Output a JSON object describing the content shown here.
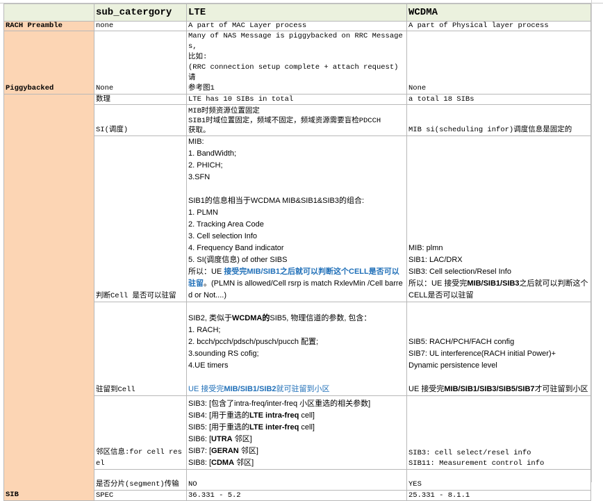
{
  "headers": {
    "col0": "",
    "col1": "sub_catergory",
    "col2": "LTE",
    "col3": "WCDMA"
  },
  "rows": {
    "rach": {
      "category": "RACH Preamble",
      "sub": "none",
      "lte": "A part of MAC Layer process",
      "wcdma": " A part of Physical layer process"
    },
    "piggy": {
      "category": "Piggybacked",
      "sub": "None",
      "lte": [
        "Many of NAS Message is piggybacked on RRC Messages,",
        "比如:",
        " (RRC connection setup complete + attach request) 请",
        "参考图1"
      ],
      "wcdma": "None"
    },
    "count": {
      "sub": "数理",
      "lte": "LTE has 10 SIBs in total",
      "wcdma": "a total 18 SIBs"
    },
    "si": {
      "sub": "SI(调度)",
      "lte": [
        "MIB时频资源位置固定",
        "SIB1时域位置固定，频域不固定，频域资源需要盲检PDCCH",
        "获取。"
      ],
      "wcdma": "MIB si(scheduling infor)调度信息是固定的"
    },
    "judge": {
      "sub": "判断Cell 是否可以驻留",
      "lte": [
        "MIB:",
        "1. BandWidth;",
        "2. PHICH;",
        "3.SFN",
        "",
        "SIB1的信息相当于WCDMA MIB&SIB1&SIB3的组合:",
        "1. PLMN",
        "2. Tracking Area Code",
        "3. Cell selection Info",
        "4. Frequency Band indicator",
        "5. SI(调度信息) of other SIBS"
      ],
      "lte_conclusion_prefix": "所以：UE ",
      "lte_conclusion_blue": "接受完MIB/SIB1之后就可以判断这个CELL是否可以驻留",
      "lte_conclusion_suffix": "。(PLMN is allowed/Cell rsrp is match RxlevMin /Cell barred or Not....)",
      "wcdma": [
        "MIB: plmn",
        "SIB1: LAC/DRX",
        "SIB3: Cell selection/Resel Info"
      ],
      "wcdma_conclusion_prefix": "所以：UE 接受完",
      "wcdma_conclusion_bold": "MIB/SIB1/SIB3",
      "wcdma_conclusion_suffix": "之后就可以判断这个CELL是否可以驻留"
    },
    "camp": {
      "sub": "驻留到Cell",
      "lte_intro_a": "SIB2, 类似于",
      "lte_intro_b": "WCDMA的",
      "lte_intro_c": "SIB5, 物理信道的参数, 包含：",
      "lte": [
        "1. RACH;",
        "2. bcch/pcch/pdsch/pusch/pucch 配置;",
        "3.sounding RS cofig;",
        "4.UE timers"
      ],
      "lte_conclusion_a": "UE 接受完",
      "lte_conclusion_b": "MIB/SIB1/SIB2",
      "lte_conclusion_c": "就可驻留到小区",
      "wcdma": [
        "SIB5: RACH/PCH/FACH config",
        "SIB7: UL interference(RACH initial Power)+",
        "Dynamic persistence level",
        ""
      ],
      "wcdma_conclusion_a": "UE 接受完",
      "wcdma_conclusion_b": "MIB/SIB1/SIB3/SIB5/SIB7",
      "wcdma_conclusion_c": "才可驻留到小区"
    },
    "neighbor": {
      "sub": "邻区信息:for cell resel",
      "lte": [
        {
          "a": "SIB3: [包含了",
          "b": "",
          "c": "intra-freq/inter-freq 小区重选的相关参数]"
        },
        {
          "a": "SIB4: [用于重选的",
          "b": "LTE intra-freq",
          "c": " cell]"
        },
        {
          "a": "SIB5: [用于重选的",
          "b": "LTE  inter-freq",
          "c": " cell]"
        },
        {
          "a": "SIB6: [",
          "b": "UTRA",
          "c": " 邻区]"
        },
        {
          "a": "SIB7: [",
          "b": "GERAN",
          "c": " 邻区]"
        },
        {
          "a": "SIB8: [",
          "b": "CDMA",
          "c": " 邻区]"
        }
      ],
      "wcdma": [
        "SIB3:   cell select/resel info",
        "SIB11: Measurement control info"
      ]
    },
    "segment": {
      "sub": "是否分片(segment)传输",
      "lte": "NO",
      "wcdma": "YES"
    },
    "spec": {
      "category": "SIB",
      "sub": "SPEC",
      "lte": "36.331 - 5.2",
      "wcdma": "25.331 - 8.1.1"
    }
  }
}
